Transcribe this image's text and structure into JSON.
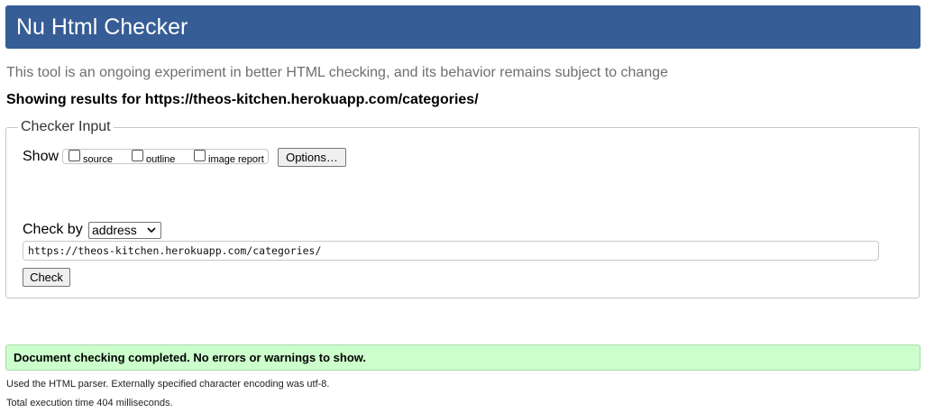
{
  "header": {
    "title": "Nu Html Checker"
  },
  "tagline": "This tool is an ongoing experiment in better HTML checking, and its behavior remains subject to change",
  "showing_results": "Showing results for https://theos-kitchen.herokuapp.com/categories/",
  "checker_input": {
    "legend": "Checker Input",
    "show_label": "Show",
    "checkboxes": [
      {
        "label": "source",
        "checked": false
      },
      {
        "label": "outline",
        "checked": false
      },
      {
        "label": "image report",
        "checked": false
      }
    ],
    "options_button": "Options…",
    "check_by_label": "Check by",
    "check_by_selected": "address",
    "url_value": "https://theos-kitchen.herokuapp.com/categories/",
    "check_button": "Check"
  },
  "result": {
    "message": "Document checking completed. No errors or warnings to show.",
    "parser_info": "Used the HTML parser. Externally specified character encoding was utf-8.",
    "execution_time": "Total execution time 404 milliseconds."
  },
  "colors": {
    "header_bg": "#365d95",
    "success_bg": "#ccffcc"
  }
}
